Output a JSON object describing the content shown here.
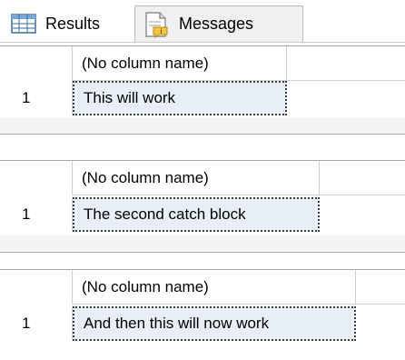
{
  "tabs": [
    {
      "label": "Results",
      "icon": "grid-icon"
    },
    {
      "label": "Messages",
      "icon": "messages-icon"
    }
  ],
  "result_sets": [
    {
      "column": "(No column name)",
      "rows": [
        {
          "num": "1",
          "value": "This will work"
        }
      ]
    },
    {
      "column": "(No column name)",
      "rows": [
        {
          "num": "1",
          "value": "The second catch block"
        }
      ]
    },
    {
      "column": "(No column name)",
      "rows": [
        {
          "num": "1",
          "value": "And then this will now work"
        }
      ]
    }
  ],
  "colors": {
    "selected_cell": "#e8eef5",
    "grid_border": "#a8a8a8"
  }
}
